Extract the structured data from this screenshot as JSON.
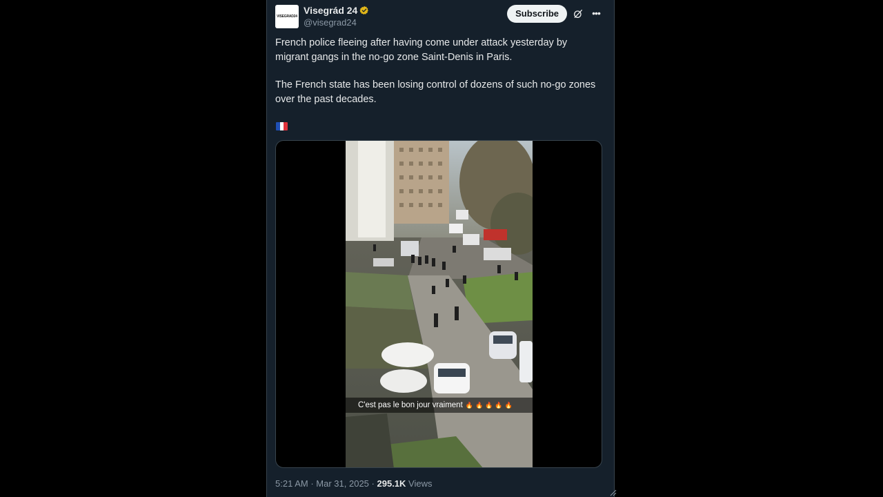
{
  "author": {
    "display_name": "Visegrád 24",
    "handle": "@visegrad24",
    "avatar_text": "VISEGRAD24",
    "verified_icon": "verified-gold-badge-icon"
  },
  "actions": {
    "subscribe_label": "Subscribe",
    "grok_icon": "grok-icon",
    "more_icon": "more-options-icon"
  },
  "tweet": {
    "paragraph_1": "French police fleeing after having come under attack yesterday by migrant gangs in the no-go zone Saint-Denis in Paris.",
    "paragraph_2": "The French state has been losing control of dozens of such no-go zones over the past decades.",
    "flag_emoji": "🇫🇷"
  },
  "media": {
    "caption": "C'est pas le bon jour vraiment",
    "caption_emojis": "🔥🔥🔥🔥🔥"
  },
  "meta": {
    "time": "5:21 AM",
    "separator": "·",
    "date": "Mar 31, 2025",
    "views_count": "295.1K",
    "views_label": "Views"
  },
  "colors": {
    "background": "#15202b",
    "text_primary": "#e7e9ea",
    "text_secondary": "#8b98a5",
    "verified_gold": "#e2b719",
    "border": "#38444d"
  }
}
